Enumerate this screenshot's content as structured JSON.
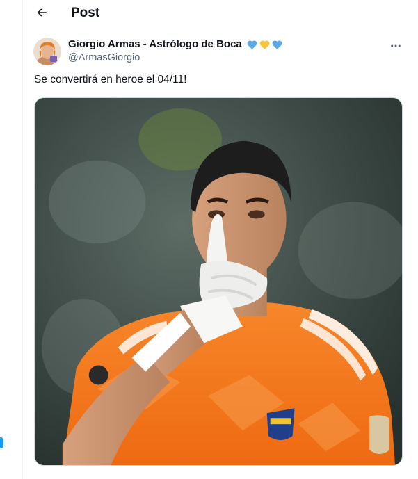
{
  "header": {
    "title": "Post",
    "back_icon": "arrow-left-icon"
  },
  "tweet": {
    "author": {
      "display_name": "Giorgio Armas - Astrólogo de Boca",
      "handle": "@ArmasGiorgio",
      "emoji_hearts": [
        "blue-heart",
        "yellow-heart",
        "blue-heart"
      ]
    },
    "text": "Se convertirá en heroe el 04/11!",
    "more_icon": "more-horizontal-icon",
    "media": {
      "kind": "photo",
      "subject": "goalkeeper-photo"
    }
  },
  "colors": {
    "accent": "#1d9bf0",
    "text_primary": "#0f1419",
    "text_secondary": "#536471",
    "border": "#cfd9de",
    "heart_blue": "#5aa9e6",
    "heart_yellow": "#f5c542",
    "jersey_orange": "#f47a1f"
  }
}
